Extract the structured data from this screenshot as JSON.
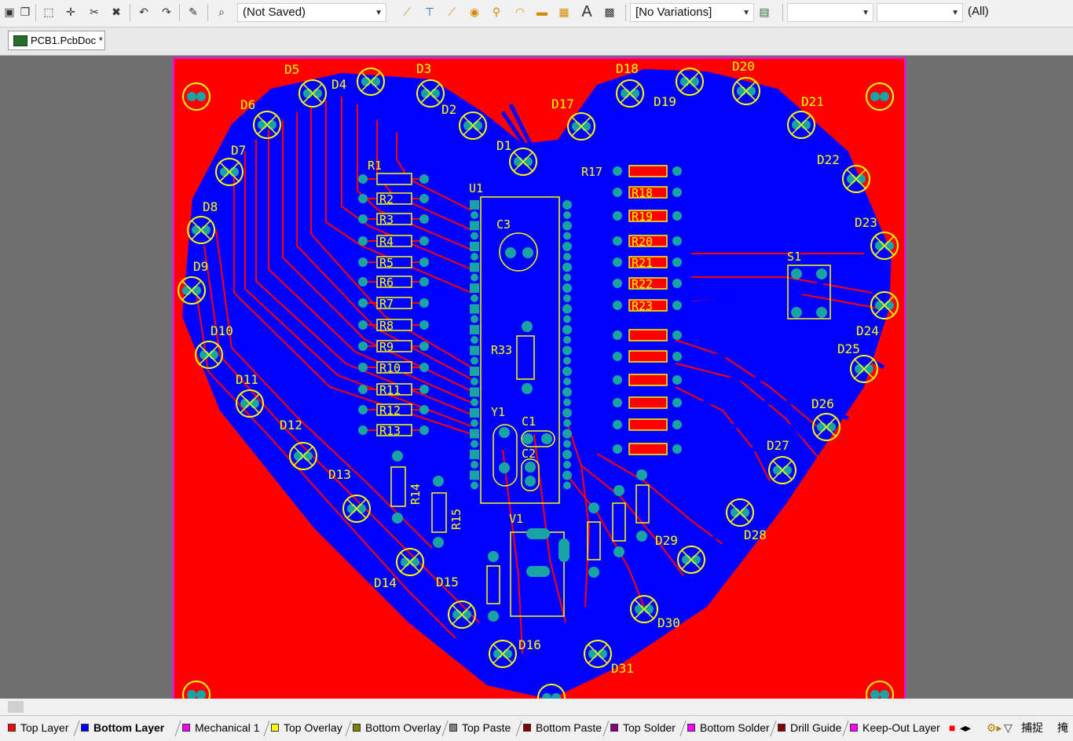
{
  "toolbar": {
    "variant_combo": "(Not Saved)",
    "variations_combo": "[No Variations]",
    "net_combo": "",
    "class_combo": "",
    "filter_combo": "(All)"
  },
  "document": {
    "tab_label": "PCB1.PcbDoc *"
  },
  "layers": [
    {
      "label": "Top Layer",
      "color": "#ff0000",
      "active": false
    },
    {
      "label": "Bottom Layer",
      "color": "#0000ff",
      "active": true
    },
    {
      "label": "Mechanical 1",
      "color": "#ff00ff",
      "active": false
    },
    {
      "label": "Top Overlay",
      "color": "#ffff00",
      "active": false
    },
    {
      "label": "Bottom Overlay",
      "color": "#808000",
      "active": false
    },
    {
      "label": "Top Paste",
      "color": "#808080",
      "active": false
    },
    {
      "label": "Bottom Paste",
      "color": "#800000",
      "active": false
    },
    {
      "label": "Top Solder",
      "color": "#800080",
      "active": false
    },
    {
      "label": "Bottom Solder",
      "color": "#ff00ff",
      "active": false
    },
    {
      "label": "Drill Guide",
      "color": "#800000",
      "active": false
    },
    {
      "label": "Keep-Out Layer",
      "color": "#ff00ff",
      "active": false
    }
  ],
  "statusbar": {
    "snap_label": "捕捉",
    "mask_label": "掩"
  },
  "colors": {
    "top_copper": "#ff0000",
    "bottom_copper": "#0000ff",
    "overlay": "#ffff00",
    "pad": "#19a3a3",
    "board_outline": "#ff00ff"
  },
  "components": {
    "leds": [
      {
        "ref": "D1"
      },
      {
        "ref": "D2"
      },
      {
        "ref": "D3"
      },
      {
        "ref": "D4"
      },
      {
        "ref": "D5"
      },
      {
        "ref": "D6"
      },
      {
        "ref": "D7"
      },
      {
        "ref": "D8"
      },
      {
        "ref": "D9"
      },
      {
        "ref": "D10"
      },
      {
        "ref": "D11"
      },
      {
        "ref": "D12"
      },
      {
        "ref": "D13"
      },
      {
        "ref": "D14"
      },
      {
        "ref": "D15"
      },
      {
        "ref": "D16"
      },
      {
        "ref": "D17"
      },
      {
        "ref": "D18"
      },
      {
        "ref": "D19"
      },
      {
        "ref": "D20"
      },
      {
        "ref": "D21"
      },
      {
        "ref": "D22"
      },
      {
        "ref": "D23"
      },
      {
        "ref": "D24"
      },
      {
        "ref": "D25"
      },
      {
        "ref": "D26"
      },
      {
        "ref": "D27"
      },
      {
        "ref": "D28"
      },
      {
        "ref": "D29"
      },
      {
        "ref": "D30"
      },
      {
        "ref": "D31"
      }
    ],
    "resistors_left": [
      "R1",
      "R2",
      "R3",
      "R4",
      "R5",
      "R6",
      "R7",
      "R8",
      "R9",
      "R10",
      "R11",
      "R12",
      "R13"
    ],
    "resistors_right": [
      "R17",
      "R18",
      "R19",
      "R20",
      "R21",
      "R22",
      "R23"
    ],
    "other": {
      "mcu": "U1",
      "cap3": "C3",
      "r33": "R33",
      "crystal": "Y1",
      "c1": "C1",
      "c2": "C2",
      "reg": "V1",
      "r14": "R14",
      "r15": "R15",
      "switch": "S1"
    }
  }
}
